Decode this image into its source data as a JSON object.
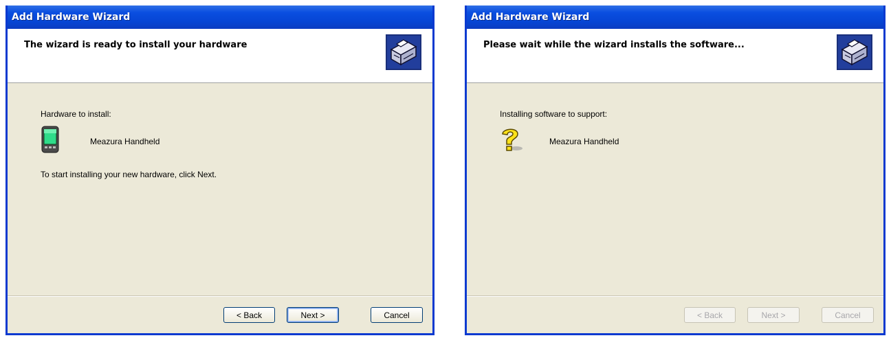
{
  "left_dialog": {
    "title": "Add Hardware Wizard",
    "heading": "The wizard is ready to install your hardware",
    "label": "Hardware to install:",
    "device": "Meazura Handheld",
    "instruction": "To start installing your new hardware, click Next.",
    "buttons": {
      "back": "< Back",
      "next": "Next >",
      "cancel": "Cancel"
    },
    "icons": {
      "header": "hardware-wizard-icon",
      "device": "handheld-device-icon"
    }
  },
  "right_dialog": {
    "title": "Add Hardware Wizard",
    "heading": "Please wait while the wizard installs the software...",
    "label": "Installing software to support:",
    "device": "Meazura Handheld",
    "buttons": {
      "back": "< Back",
      "next": "Next >",
      "cancel": "Cancel"
    },
    "buttons_disabled": true,
    "icons": {
      "header": "hardware-wizard-icon",
      "device": "question-mark-icon"
    }
  },
  "colors": {
    "titlebar": "#0a4ee0",
    "dialog_bg": "#ece9d8",
    "header_bg": "#ffffff",
    "border": "#0a3ad0"
  }
}
